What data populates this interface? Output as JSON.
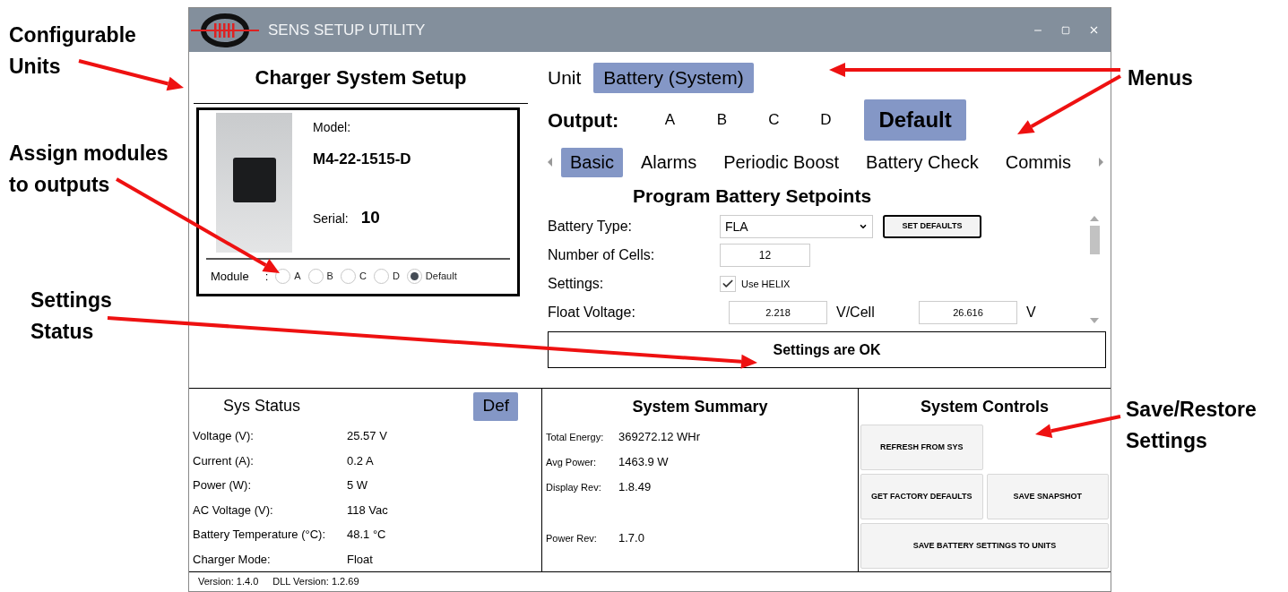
{
  "callouts": [
    {
      "text": "Configurable Units"
    },
    {
      "text": "Assign modules to outputs"
    },
    {
      "text": "Settings Status"
    },
    {
      "text": "Menus"
    },
    {
      "text": "Save/Restore Settings"
    }
  ],
  "window": {
    "title": "SENS SETUP UTILITY"
  },
  "setup": {
    "title": "Charger System Setup",
    "model_label": "Model:",
    "model": "M4-22-1515-D",
    "serial_label": "Serial:",
    "serial": "10",
    "module_label": "Module",
    "module_separator": ":",
    "modules": [
      {
        "label": "A",
        "selected": false
      },
      {
        "label": "B",
        "selected": false
      },
      {
        "label": "C",
        "selected": false
      },
      {
        "label": "D",
        "selected": false
      },
      {
        "label": "Default",
        "selected": true
      }
    ]
  },
  "unit_menu": {
    "label": "Unit",
    "items": [
      {
        "label": "Battery (System)",
        "selected": true
      }
    ]
  },
  "output_menu": {
    "label": "Output:",
    "items": [
      {
        "label": "A",
        "selected": false
      },
      {
        "label": "B",
        "selected": false
      },
      {
        "label": "C",
        "selected": false
      },
      {
        "label": "D",
        "selected": false
      },
      {
        "label": "Default",
        "selected": true
      }
    ]
  },
  "tabs": [
    {
      "label": "Basic",
      "selected": true
    },
    {
      "label": "Alarms",
      "selected": false
    },
    {
      "label": "Periodic Boost",
      "selected": false
    },
    {
      "label": "Battery Check",
      "selected": false
    },
    {
      "label": "Commis",
      "selected": false
    }
  ],
  "section_title": "Program Battery Setpoints",
  "form": [
    {
      "kind": "select",
      "label": "Battery Type:",
      "value": "FLA",
      "button": "SET DEFAULTS"
    },
    {
      "kind": "input",
      "label": "Number of Cells:",
      "value": "12"
    },
    {
      "kind": "checkbox",
      "label": "Settings:",
      "option": "Use HELIX",
      "checked": true
    },
    {
      "kind": "dual",
      "label": "Float Voltage:",
      "value": "2.218",
      "unit": "V/Cell",
      "value_2": "26.616",
      "unit_2": "V"
    }
  ],
  "status": "Settings are OK",
  "sys_status": {
    "title": "Sys Status",
    "button": "Def",
    "rows": [
      {
        "label": "Voltage (V):",
        "value": "25.57 V"
      },
      {
        "label": "Current (A):",
        "value": "0.2 A"
      },
      {
        "label": "Power (W):",
        "value": "5 W"
      },
      {
        "label": "AC Voltage (V):",
        "value": "118 Vac"
      },
      {
        "label": "Battery Temperature (°C):",
        "value": "48.1 °C"
      },
      {
        "label": "Charger Mode:",
        "value": "Float"
      }
    ]
  },
  "summary": {
    "title": "System Summary",
    "rows": [
      {
        "label": "Total Energy:",
        "value": "369272.12 WHr"
      },
      {
        "label": "Avg Power:",
        "value": "1463.9 W"
      },
      {
        "label": "Display Rev:",
        "value": "1.8.49"
      },
      {
        "label": "Power Rev:",
        "value": "1.7.0"
      }
    ]
  },
  "controls": {
    "title": "System Controls",
    "buttons": [
      "REFRESH FROM SYS",
      "GET FACTORY DEFAULTS",
      "SAVE SNAPSHOT",
      "SAVE BATTERY SETTINGS TO UNITS"
    ]
  },
  "footer": {
    "version": "Version: 1.4.0",
    "dll_version": "DLL Version: 1.2.69"
  }
}
